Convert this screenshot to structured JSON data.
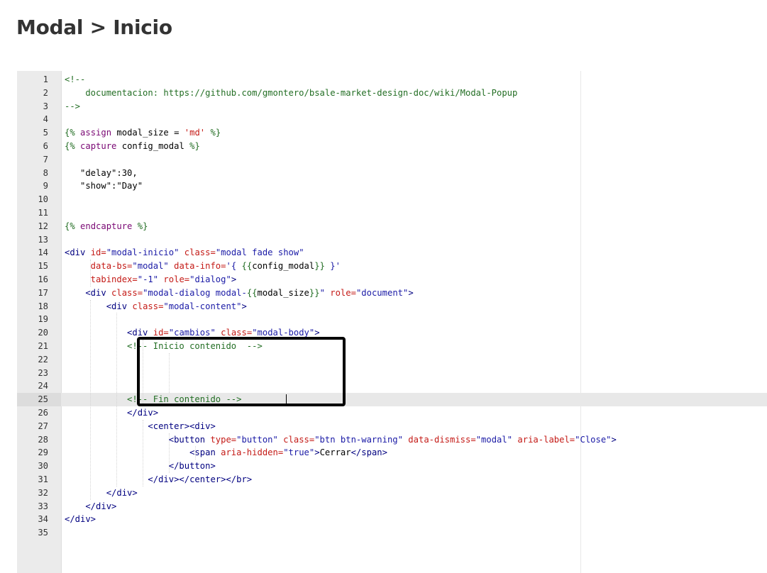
{
  "header": {
    "title": "Modal > Inicio"
  },
  "editor": {
    "active_line": 25,
    "lines": [
      [
        {
          "t": "<!--",
          "c": "comment"
        }
      ],
      [
        {
          "t": "    documentacion: https://github.com/gmontero/bsale-market-design-doc/wiki/Modal-Popup",
          "c": "comment"
        }
      ],
      [
        {
          "t": "-->",
          "c": "comment"
        }
      ],
      [],
      [
        {
          "t": "{%",
          "c": "liq"
        },
        {
          "t": " assign ",
          "c": "liqkw"
        },
        {
          "t": "modal_size",
          "c": "text"
        },
        {
          "t": " = ",
          "c": "text"
        },
        {
          "t": "'md'",
          "c": "attr"
        },
        {
          "t": " %}",
          "c": "liq"
        }
      ],
      [
        {
          "t": "{%",
          "c": "liq"
        },
        {
          "t": " capture ",
          "c": "liqkw"
        },
        {
          "t": "config_modal",
          "c": "text"
        },
        {
          "t": " %}",
          "c": "liq"
        }
      ],
      [],
      [
        {
          "t": "   \"delay\":30,",
          "c": "text"
        }
      ],
      [
        {
          "t": "   \"show\":\"Day\"",
          "c": "text"
        }
      ],
      [],
      [],
      [
        {
          "t": "{%",
          "c": "liq"
        },
        {
          "t": " endcapture ",
          "c": "liqkw"
        },
        {
          "t": "%}",
          "c": "liq"
        }
      ],
      [],
      [
        {
          "t": "<div ",
          "c": "tag"
        },
        {
          "t": "id=",
          "c": "attr"
        },
        {
          "t": "\"modal-inicio\"",
          "c": "str"
        },
        {
          "t": " class=",
          "c": "attr"
        },
        {
          "t": "\"modal fade show\"",
          "c": "str"
        }
      ],
      [
        {
          "t": "     data-bs=",
          "c": "attr"
        },
        {
          "t": "\"modal\"",
          "c": "str"
        },
        {
          "t": " data-info=",
          "c": "attr"
        },
        {
          "t": "'{ ",
          "c": "str"
        },
        {
          "t": "{{",
          "c": "liq"
        },
        {
          "t": "config_modal",
          "c": "text"
        },
        {
          "t": "}}",
          "c": "liq"
        },
        {
          "t": " }'",
          "c": "str"
        }
      ],
      [
        {
          "t": "     tabindex=",
          "c": "attr"
        },
        {
          "t": "\"-1\"",
          "c": "str"
        },
        {
          "t": " role=",
          "c": "attr"
        },
        {
          "t": "\"dialog\"",
          "c": "str"
        },
        {
          "t": ">",
          "c": "tag"
        }
      ],
      [
        {
          "t": "    <div ",
          "c": "tag"
        },
        {
          "t": "class=",
          "c": "attr"
        },
        {
          "t": "\"modal-dialog modal-",
          "c": "str"
        },
        {
          "t": "{{",
          "c": "liq"
        },
        {
          "t": "modal_size",
          "c": "text"
        },
        {
          "t": "}}",
          "c": "liq"
        },
        {
          "t": "\"",
          "c": "str"
        },
        {
          "t": " role=",
          "c": "attr"
        },
        {
          "t": "\"document\"",
          "c": "str"
        },
        {
          "t": ">",
          "c": "tag"
        }
      ],
      [
        {
          "t": "        <div ",
          "c": "tag"
        },
        {
          "t": "class=",
          "c": "attr"
        },
        {
          "t": "\"modal-content\"",
          "c": "str"
        },
        {
          "t": ">",
          "c": "tag"
        }
      ],
      [],
      [
        {
          "t": "            <div ",
          "c": "tag"
        },
        {
          "t": "id=",
          "c": "attr"
        },
        {
          "t": "\"cambios\"",
          "c": "str"
        },
        {
          "t": " class=",
          "c": "attr"
        },
        {
          "t": "\"modal-body\"",
          "c": "str"
        },
        {
          "t": ">",
          "c": "tag"
        }
      ],
      [
        {
          "t": "            <!-- Inicio contenido  -->",
          "c": "comment"
        }
      ],
      [],
      [],
      [],
      [
        {
          "t": "            <!-- Fin contenido -->",
          "c": "comment"
        }
      ],
      [
        {
          "t": "            </div>",
          "c": "tag"
        }
      ],
      [
        {
          "t": "                <center><div>",
          "c": "tag"
        }
      ],
      [
        {
          "t": "                    <button ",
          "c": "tag"
        },
        {
          "t": "type=",
          "c": "attr"
        },
        {
          "t": "\"button\"",
          "c": "str"
        },
        {
          "t": " class=",
          "c": "attr"
        },
        {
          "t": "\"btn btn-warning\"",
          "c": "str"
        },
        {
          "t": " data-dismiss=",
          "c": "attr"
        },
        {
          "t": "\"modal\"",
          "c": "str"
        },
        {
          "t": " aria-label=",
          "c": "attr"
        },
        {
          "t": "\"Close\"",
          "c": "str"
        },
        {
          "t": ">",
          "c": "tag"
        }
      ],
      [
        {
          "t": "                        <span ",
          "c": "tag"
        },
        {
          "t": "aria-hidden=",
          "c": "attr"
        },
        {
          "t": "\"true\"",
          "c": "str"
        },
        {
          "t": ">",
          "c": "tag"
        },
        {
          "t": "Cerrar",
          "c": "text"
        },
        {
          "t": "</span>",
          "c": "tag"
        }
      ],
      [
        {
          "t": "                    </button>",
          "c": "tag"
        }
      ],
      [
        {
          "t": "                </div></center></br>",
          "c": "tag"
        }
      ],
      [
        {
          "t": "        </div>",
          "c": "tag"
        }
      ],
      [
        {
          "t": "    </div>",
          "c": "tag"
        }
      ],
      [
        {
          "t": "</div>",
          "c": "tag"
        }
      ],
      []
    ]
  }
}
